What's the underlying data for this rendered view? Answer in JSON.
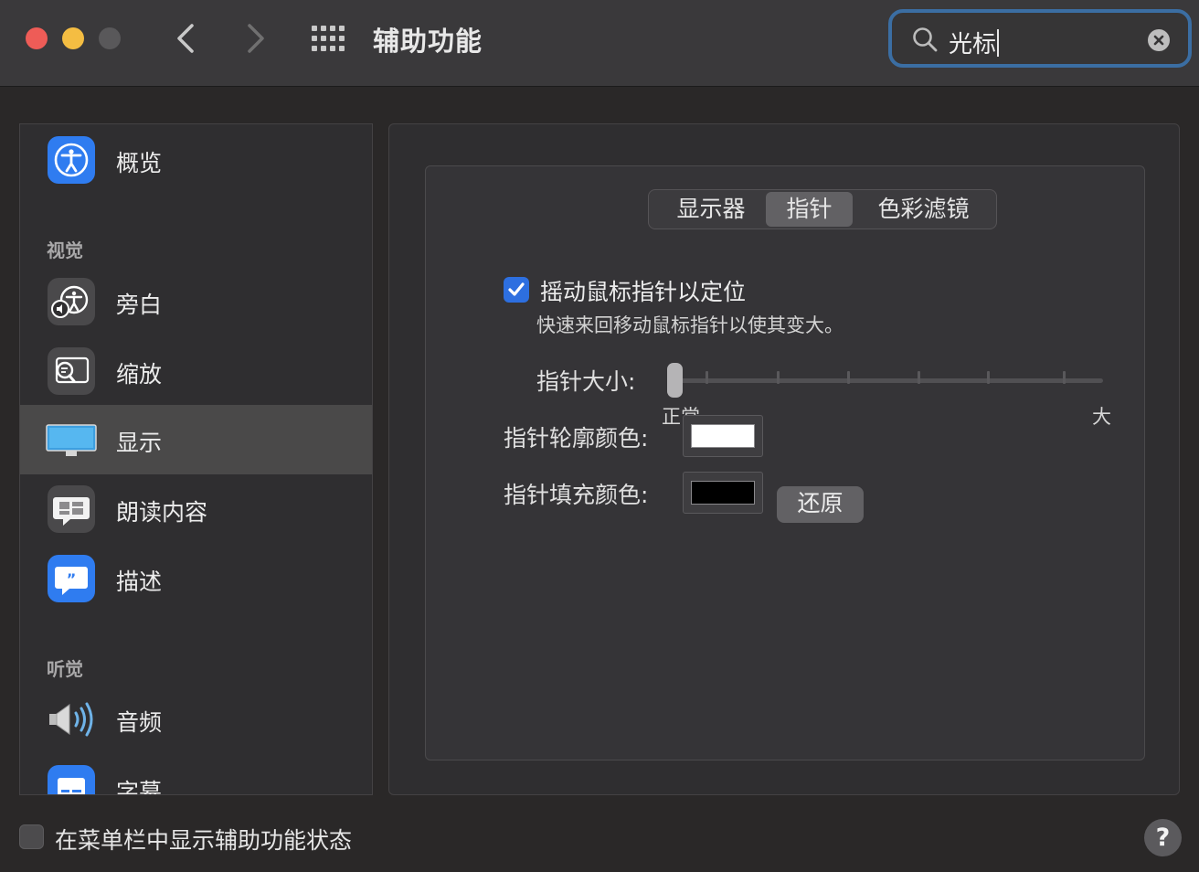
{
  "window": {
    "title": "辅助功能",
    "search": {
      "value": "光标"
    }
  },
  "sidebar": {
    "items": [
      {
        "label": "概览",
        "icon": "accessibility-icon"
      },
      {
        "section": "视觉"
      },
      {
        "label": "旁白",
        "icon": "voiceover-icon"
      },
      {
        "label": "缩放",
        "icon": "zoom-icon"
      },
      {
        "label": "显示",
        "icon": "display-icon",
        "selected": true
      },
      {
        "label": "朗读内容",
        "icon": "spoken-content-icon"
      },
      {
        "label": "描述",
        "icon": "descriptions-icon"
      },
      {
        "section": "听觉"
      },
      {
        "label": "音频",
        "icon": "speaker-icon"
      },
      {
        "label": "字幕",
        "icon": "captions-icon"
      }
    ]
  },
  "tabs": [
    {
      "label": "显示器"
    },
    {
      "label": "指针",
      "active": true
    },
    {
      "label": "色彩滤镜"
    }
  ],
  "pointer": {
    "shake_label": "摇动鼠标指针以定位",
    "shake_checked": true,
    "shake_desc": "快速来回移动鼠标指针以使其变大。",
    "size_label": "指针大小:",
    "size_min": "正常",
    "size_max": "大",
    "size_value": 0,
    "outline_label": "指针轮廓颜色:",
    "outline_color": "#ffffff",
    "fill_label": "指针填充颜色:",
    "fill_color": "#000000",
    "reset_label": "还原"
  },
  "footer": {
    "menubar_label": "在菜单栏中显示辅助功能状态",
    "menubar_checked": false,
    "help_label": "?"
  },
  "colors": {
    "accent": "#2d6fe0",
    "search_focus": "#3b6ea3"
  }
}
